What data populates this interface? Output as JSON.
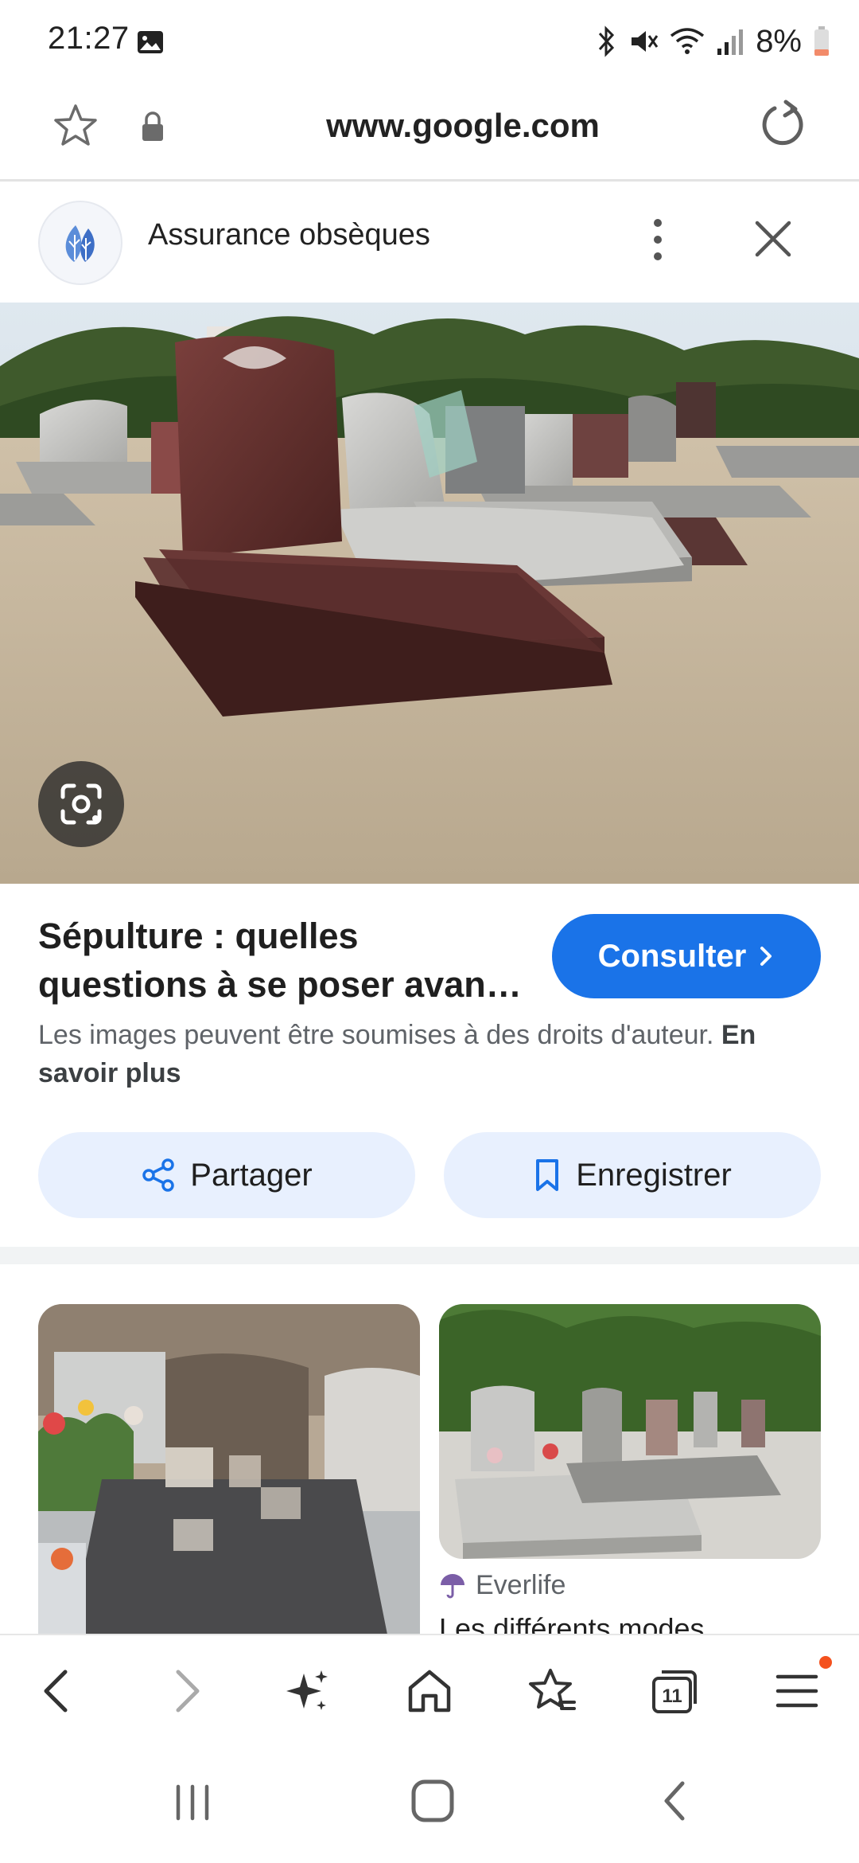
{
  "status_bar": {
    "time": "21:27",
    "battery": "8%",
    "icons": [
      "gallery-icon",
      "bluetooth-icon",
      "mute-icon",
      "wifi-icon",
      "signal-icon",
      "battery-icon"
    ]
  },
  "address_bar": {
    "url": "www.google.com"
  },
  "ad": {
    "title": "Assurance obsèques"
  },
  "result": {
    "title": "Sépulture : quelles questions à se poser avan…",
    "consult_label": "Consulter",
    "copyright_text": "Les images peuvent être soumises à des droits d'auteur.",
    "learn_more": "En savoir plus",
    "share_label": "Partager",
    "save_label": "Enregistrer"
  },
  "related": {
    "source_name": "Everlife",
    "title_partial": "Les différents modes"
  },
  "colors": {
    "accent": "#1a73e8",
    "chip_bg": "#e8f0fe",
    "notification": "#f4511e"
  }
}
